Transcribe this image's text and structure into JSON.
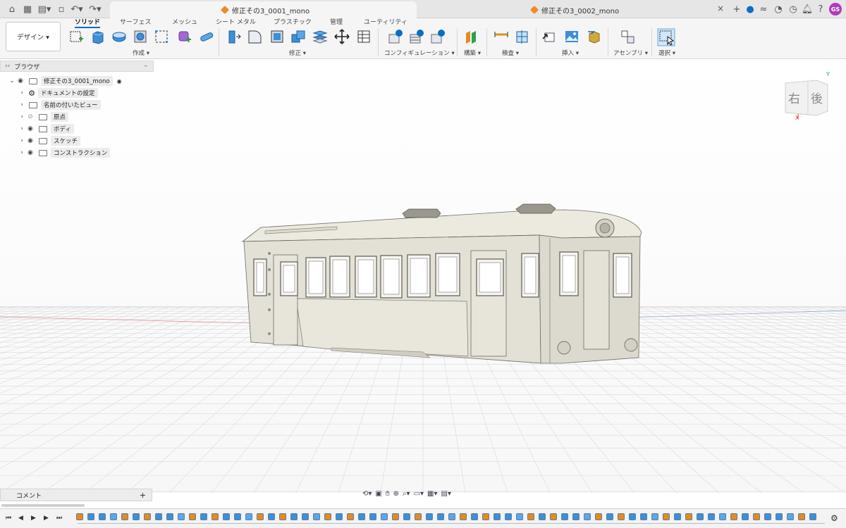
{
  "document_tabs": [
    {
      "label": "修正その3_0001_mono",
      "active": true
    },
    {
      "label": "修正その3_0002_mono",
      "active": false
    }
  ],
  "user_initials": "GS",
  "workspace": {
    "label": "デザイン ▾"
  },
  "ribbon_tabs": [
    "ソリッド",
    "サーフェス",
    "メッシュ",
    "シート メタル",
    "プラスチック",
    "管理",
    "ユーティリティ"
  ],
  "ribbon_groups": {
    "create": "作成 ▾",
    "modify": "修正 ▾",
    "configure": "コンフィギュレーション ▾",
    "construct": "構築 ▾",
    "inspect": "検査 ▾",
    "insert": "挿入 ▾",
    "assemble": "アセンブリ ▾",
    "select": "選択 ▾"
  },
  "browser": {
    "title": "ブラウザ",
    "collapse": "–",
    "root": "修正その3_0001_mono",
    "items": [
      "ドキュメントの設定",
      "名前の付いたビュー",
      "原点",
      "ボディ",
      "スケッチ",
      "コンストラクション"
    ]
  },
  "view_cube": {
    "face_right": "右",
    "face_back": "後",
    "axis_y": "Y",
    "axis_x": "X"
  },
  "comments": {
    "label": "コメント",
    "add": "+"
  },
  "colors": {
    "accent": "#0a6ec2",
    "model": "#e3e0d5",
    "avatar": "#b03bbf"
  }
}
